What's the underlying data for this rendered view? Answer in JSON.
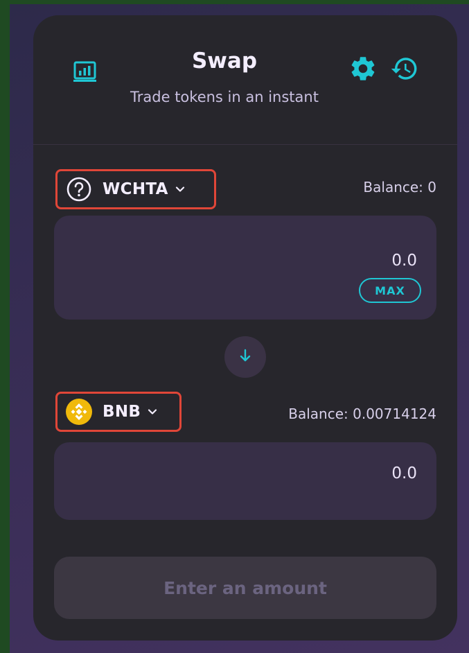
{
  "header": {
    "title": "Swap",
    "subtitle": "Trade tokens in an instant",
    "icons": {
      "chart": "bar-chart-icon",
      "settings": "gear-icon",
      "history": "history-icon"
    }
  },
  "from_token": {
    "symbol": "WCHTA",
    "icon": "question-circle-icon",
    "balance_label": "Balance: 0",
    "amount_placeholder": "0.0",
    "max_label": "MAX"
  },
  "to_token": {
    "symbol": "BNB",
    "icon": "bnb-token-icon",
    "balance_label": "Balance: 0.00714124",
    "amount_placeholder": "0.0"
  },
  "switch": {
    "icon": "arrow-down-icon"
  },
  "submit": {
    "label": "Enter an amount"
  },
  "colors": {
    "accent": "#1fc7d4",
    "card": "#27262c",
    "input": "#372f47",
    "highlight": "#e04638",
    "bnb": "#f0b90b"
  }
}
